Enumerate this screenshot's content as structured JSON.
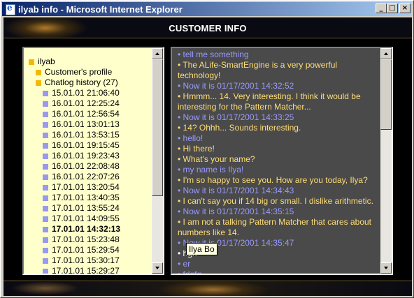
{
  "window": {
    "title": "ilyab info - Microsoft Internet Explorer",
    "buttons": {
      "minimize": "_",
      "maximize": "□",
      "close": "×"
    }
  },
  "header": {
    "title": "CUSTOMER INFO"
  },
  "tree": {
    "root": "ilyab",
    "items": [
      {
        "label": "Customer's profile",
        "level": 1,
        "icon": "gold"
      },
      {
        "label": "Chatlog history (27)",
        "level": 1,
        "icon": "gold"
      },
      {
        "label": "15.01.01 21:06:40",
        "level": 2,
        "icon": "lav"
      },
      {
        "label": "16.01.01 12:25:24",
        "level": 2,
        "icon": "lav"
      },
      {
        "label": "16.01.01 12:56:54",
        "level": 2,
        "icon": "lav"
      },
      {
        "label": "16.01.01 13:01:13",
        "level": 2,
        "icon": "lav"
      },
      {
        "label": "16.01.01 13:53:15",
        "level": 2,
        "icon": "lav"
      },
      {
        "label": "16.01.01 19:15:45",
        "level": 2,
        "icon": "lav"
      },
      {
        "label": "16.01.01 19:23:43",
        "level": 2,
        "icon": "lav"
      },
      {
        "label": "16.01.01 22:08:48",
        "level": 2,
        "icon": "lav"
      },
      {
        "label": "16.01.01 22:07:26",
        "level": 2,
        "icon": "lav"
      },
      {
        "label": "17.01.01 13:20:54",
        "level": 2,
        "icon": "lav"
      },
      {
        "label": "17.01.01 13:40:35",
        "level": 2,
        "icon": "lav"
      },
      {
        "label": "17.01.01 13:55:24",
        "level": 2,
        "icon": "lav"
      },
      {
        "label": "17.01.01 14:09:55",
        "level": 2,
        "icon": "lav"
      },
      {
        "label": "17.01.01 14:32:13",
        "level": 2,
        "icon": "lav",
        "selected": true
      },
      {
        "label": "17.01.01 15:23:48",
        "level": 2,
        "icon": "lav"
      },
      {
        "label": "17.01.01 15:29:54",
        "level": 2,
        "icon": "lav"
      },
      {
        "label": "17.01.01 15:30:17",
        "level": 2,
        "icon": "lav"
      },
      {
        "label": "17.01.01 15:29:27",
        "level": 2,
        "icon": "lav"
      }
    ]
  },
  "chat": {
    "messages": [
      {
        "role": "user",
        "text": "• tell me something"
      },
      {
        "role": "bot",
        "text": "• The ALife-SmartEngine is a very powerful technology!"
      },
      {
        "role": "user",
        "text": "• Now it is 01/17/2001 14:32:52"
      },
      {
        "role": "bot",
        "text": "• Hmmm... 14. Very interesting. I think it would be interesting for the Pattern Matcher..."
      },
      {
        "role": "user",
        "text": "• Now it is 01/17/2001 14:33:25"
      },
      {
        "role": "bot",
        "text": "• 14? Ohhh... Sounds interesting."
      },
      {
        "role": "user",
        "text": "• hello!"
      },
      {
        "role": "bot",
        "text": "• Hi there!"
      },
      {
        "role": "bot",
        "text": "• What's your name?"
      },
      {
        "role": "user",
        "text": "• my name is Ilya!"
      },
      {
        "role": "bot",
        "text": "• I'm so happy to see you. How are you today, Ilya?"
      },
      {
        "role": "user",
        "text": "• Now it is 01/17/2001 14:34:43"
      },
      {
        "role": "bot",
        "text": "• I can't say you if 14 big or small. I dislike arithmetic."
      },
      {
        "role": "user",
        "text": "• Now it is 01/17/2001 14:35:15"
      },
      {
        "role": "bot",
        "text": "• I am not a talking Pattern Matcher that cares about numbers like 14."
      },
      {
        "role": "user",
        "text": "• Now it is 01/17/2001 14:35:47"
      },
      {
        "role": "plain",
        "text": "• hgh"
      },
      {
        "role": "user",
        "text": "• er"
      },
      {
        "role": "user",
        "text": "• fdgfg"
      }
    ]
  },
  "tooltip": {
    "text": "Ilya Bo"
  },
  "colors": {
    "user": "#9999ff",
    "bot": "#ffdd77",
    "tree_bg": "#ffffcc",
    "chat_bg": "#4a4a4a"
  }
}
